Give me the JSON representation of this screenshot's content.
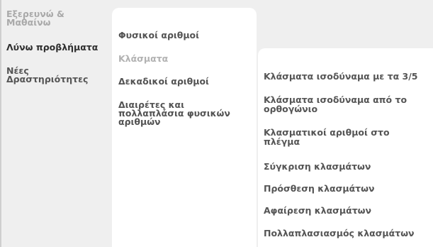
{
  "nav": {
    "items": [
      {
        "label": "Εξερευνώ &\nΜαθαίνω"
      },
      {
        "label": "Λύνω προβλήματα"
      },
      {
        "label": "Νέες\nΔραστηριότητες"
      }
    ]
  },
  "topics": {
    "items": [
      {
        "label": "Φυσικοί αριθμοί"
      },
      {
        "label": "Κλάσματα"
      },
      {
        "label": "Δεκαδικοί αριθμοί"
      },
      {
        "label": "Διαιρέτες και πολλαπλάσια φυσικών αριθμών"
      }
    ]
  },
  "activities": {
    "items": [
      {
        "label": "Κλάσματα ισοδύναμα με τα 3/5"
      },
      {
        "label": "Κλάσματα ισοδύναμα από το ορθογώνιο"
      },
      {
        "label": "Κλασματικοί αριθμοί στο πλέγμα"
      },
      {
        "label": "Σύγκριση κλασμάτων"
      },
      {
        "label": "Πρόσθεση κλασμάτων"
      },
      {
        "label": "Αφαίρεση κλασμάτων"
      },
      {
        "label": "Πολλαπλασιασμός κλασμάτων"
      }
    ]
  }
}
